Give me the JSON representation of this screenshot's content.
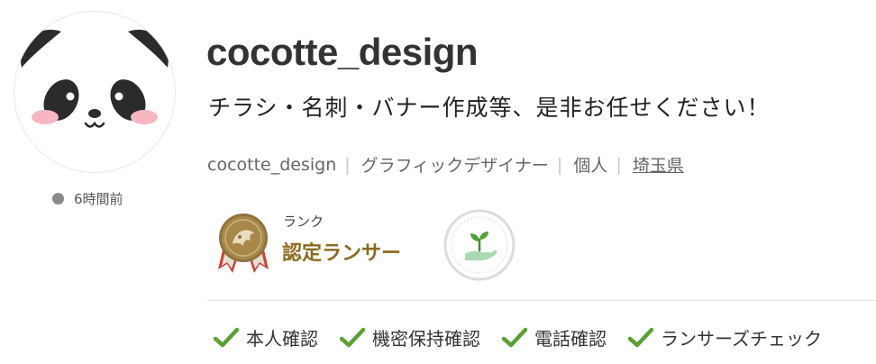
{
  "profile": {
    "username": "cocotte_design",
    "catchphrase": "チラシ・名刺・バナー作成等、是非お任せください！",
    "last_active": "6時間前",
    "avatar_icon": "panda-face-icon",
    "presence_color": "#8a8a8a"
  },
  "meta": {
    "display_name": "cocotte_design",
    "occupation": "グラフィックデザイナー",
    "entity_type": "個人",
    "location": "埼玉県",
    "separator": "|"
  },
  "rank": {
    "caption": "ランク",
    "name": "認定ランサー",
    "medal_icon": "certified-medal-icon",
    "badge_icon": "sprout-hand-icon",
    "name_color": "#8a6b1f"
  },
  "verifications": [
    {
      "label": "本人確認",
      "icon": "check-icon"
    },
    {
      "label": "機密保持確認",
      "icon": "check-icon"
    },
    {
      "label": "電話確認",
      "icon": "check-icon"
    },
    {
      "label": "ランサーズチェック",
      "icon": "check-icon"
    }
  ],
  "colors": {
    "check_green": "#5aa135",
    "medal_gold": "#a8884a",
    "ribbon_red": "#c9453a"
  }
}
